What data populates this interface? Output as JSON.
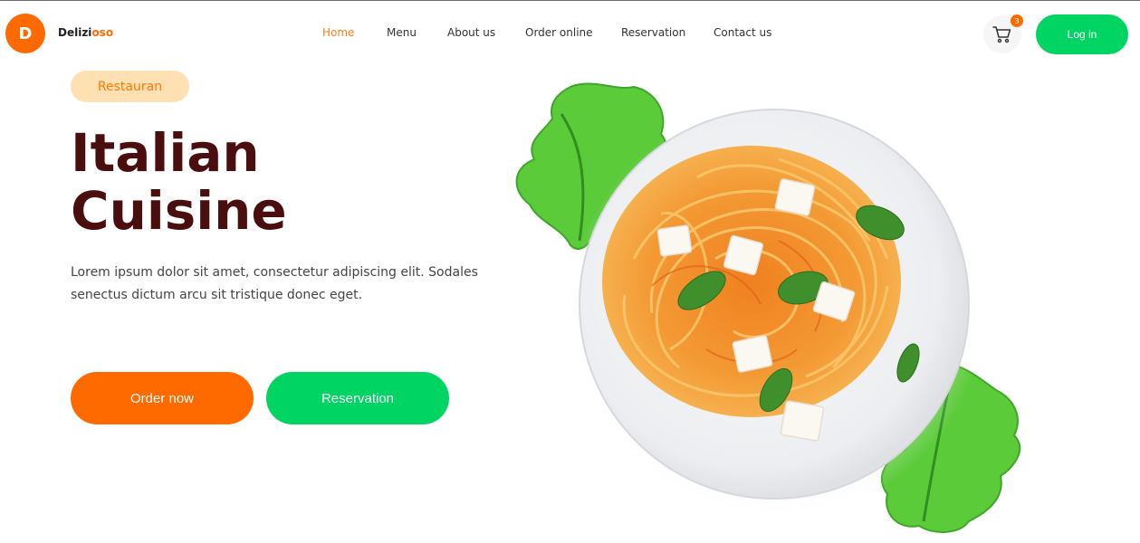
{
  "brand": {
    "logo_letter": "D",
    "name_main": "Delizi",
    "name_accent": "oso"
  },
  "nav": [
    {
      "label": "Home",
      "active": true
    },
    {
      "label": "Menu"
    },
    {
      "label": "About us"
    },
    {
      "label": "Order online"
    },
    {
      "label": "Reservation"
    },
    {
      "label": "Contact us"
    }
  ],
  "cart": {
    "count": "3",
    "icon": "cart-icon"
  },
  "login_label": "Log in",
  "hero": {
    "tag": "Restauran",
    "title_line1": "Italian",
    "title_line2": "Cuisine",
    "description": "Lorem ipsum dolor sit amet, consectetur adipiscing elit. Sodales senectus dictum arcu sit tristique donec eget.",
    "order_label": "Order now",
    "reservation_label": "Reservation"
  },
  "colors": {
    "accent": "#ff6a00",
    "green": "#00d463",
    "title": "#4a0e0e",
    "tag_bg": "#ffe0b3"
  }
}
